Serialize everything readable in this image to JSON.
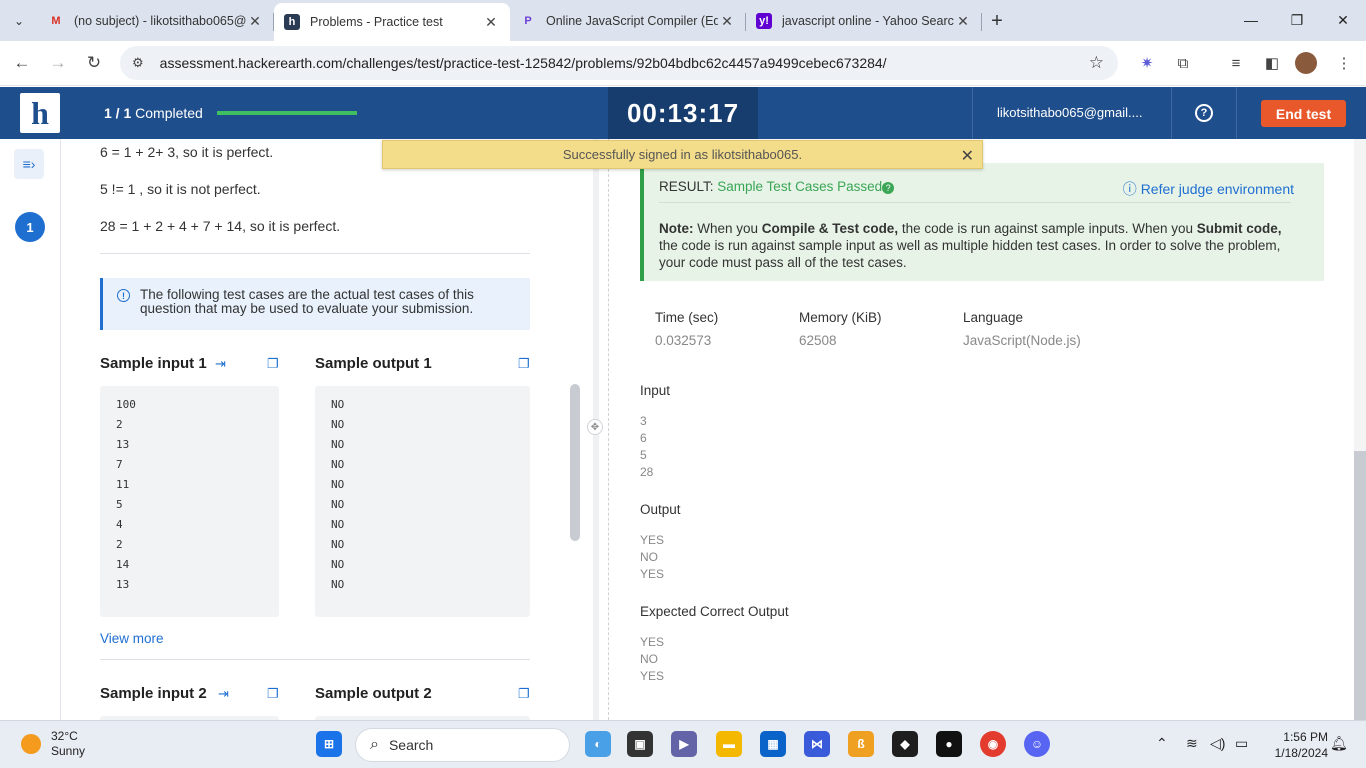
{
  "browser": {
    "tabs": [
      {
        "title": "(no subject) - likotsithabo065@",
        "icon": "gmail-icon",
        "color": "#d93025"
      },
      {
        "title": "Problems - Practice test",
        "icon": "hackerearth-icon",
        "color": "#2b3a55"
      },
      {
        "title": "Online JavaScript Compiler (Edi",
        "icon": "compiler-icon",
        "color": "#6c3fd6"
      },
      {
        "title": "javascript online - Yahoo Search",
        "icon": "yahoo-icon",
        "color": "#6001d2"
      }
    ],
    "url": "assessment.hackerearth.com/challenges/test/practice-test-125842/problems/92b04bdbc62c4457a9499cebec673284/"
  },
  "header": {
    "progress_count": "1 / 1",
    "progress_label": "Completed",
    "progress_fraction": 1.0,
    "timer": "00:13:17",
    "user": "likotsithabo065@gmail....",
    "end_test": "End test"
  },
  "sidebar": {
    "question_number": "1"
  },
  "problem": {
    "lines": [
      "6 = 1 + 2+ 3, so it is perfect.",
      "5 != 1 , so it is not perfect.",
      "28 = 1 + 2 + 4 + 7 + 14, so it is perfect."
    ],
    "notice": "The following test cases are the actual test cases of this question that may be used to evaluate your submission.",
    "sample_input_1_title": "Sample input 1",
    "sample_output_1_title": "Sample output 1",
    "sample_input_1": [
      "100",
      "2",
      "13",
      "7",
      "11",
      "5",
      "4",
      "2",
      "14",
      "13"
    ],
    "sample_output_1": [
      "NO",
      "NO",
      "NO",
      "NO",
      "NO",
      "NO",
      "NO",
      "NO",
      "NO",
      "NO"
    ],
    "view_more": "View more",
    "sample_input_2_title": "Sample input 2",
    "sample_output_2_title": "Sample output 2"
  },
  "toast": {
    "message": "Successfully signed in as likotsithabo065."
  },
  "result": {
    "label": "RESULT:",
    "status": "Sample Test Cases Passed",
    "judge_link": "Refer judge environment",
    "note_prefix": "Note:",
    "note_1": " When you ",
    "note_compile": "Compile & Test code,",
    "note_2": " the code is run against sample inputs. When you ",
    "note_submit": "Submit code,",
    "note_3": " the code is run against sample input as well as multiple hidden test cases. In order to solve the problem, your code must pass all of the test cases."
  },
  "stats": {
    "time_label": "Time (sec)",
    "time_value": "0.032573",
    "memory_label": "Memory (KiB)",
    "memory_value": "62508",
    "language_label": "Language",
    "language_value": "JavaScript(Node.js)"
  },
  "io": {
    "input_label": "Input",
    "input": [
      "3",
      "6",
      "5",
      "28"
    ],
    "output_label": "Output",
    "output": [
      "YES",
      "NO",
      "YES"
    ],
    "expected_label": "Expected Correct Output",
    "expected": [
      "YES",
      "NO",
      "YES"
    ]
  },
  "taskbar": {
    "temp": "32°C",
    "condition": "Sunny",
    "search": "Search",
    "time": "1:56 PM",
    "date": "1/18/2024"
  }
}
